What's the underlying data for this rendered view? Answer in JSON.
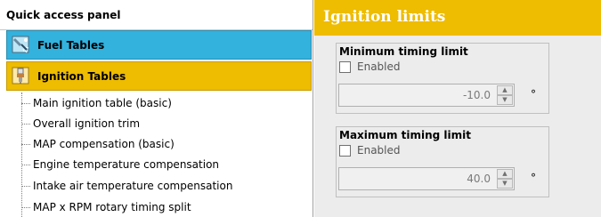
{
  "left_panel": {
    "title": "Quick access panel",
    "categories": [
      {
        "label": "Fuel Tables",
        "icon": "fuel-injector-icon",
        "color": "#33b2de"
      },
      {
        "label": "Ignition Tables",
        "icon": "spark-plug-icon",
        "color": "#eebc00"
      }
    ],
    "tree_items": [
      "Main ignition table (basic)",
      "Overall ignition trim",
      "MAP compensation (basic)",
      "Engine temperature compensation",
      "Intake air temperature compensation",
      "MAP x RPM rotary timing split"
    ]
  },
  "right_panel": {
    "title": "Ignition limits",
    "accent_color": "#eebc00",
    "groups": [
      {
        "title": "Minimum timing limit",
        "checkbox_label": "Enabled",
        "checked": false,
        "value": "-10.0",
        "unit": "°"
      },
      {
        "title": "Maximum timing limit",
        "checkbox_label": "Enabled",
        "checked": false,
        "value": "40.0",
        "unit": "°"
      }
    ]
  }
}
